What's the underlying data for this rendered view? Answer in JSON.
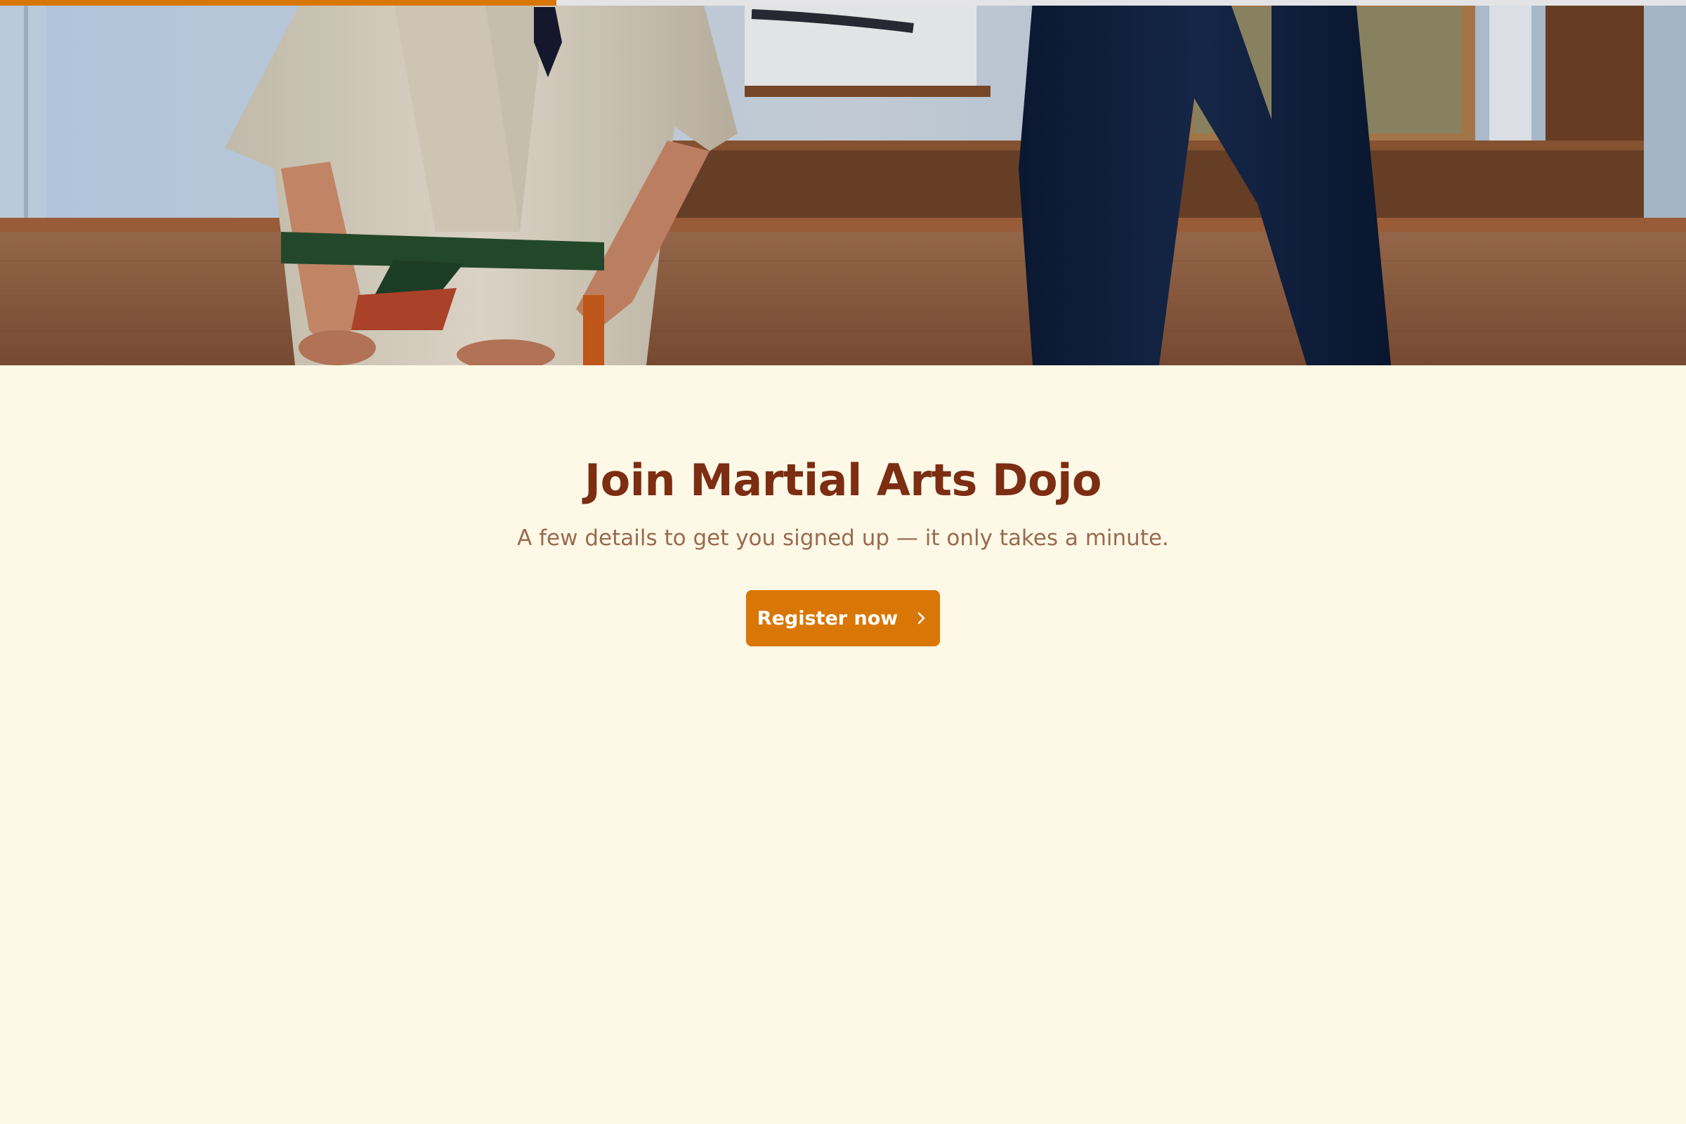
{
  "progress": {
    "percent": 33
  },
  "hero": {
    "alt_icon": "dojo-photo"
  },
  "signup": {
    "title": "Join Martial Arts Dojo",
    "subtitle": "A few details to get you signed up — it only takes a minute.",
    "register_label": "Register now",
    "register_icon": "chevron-right-icon"
  },
  "colors": {
    "background": "#fef9e7",
    "accent": "#d97706",
    "title": "#7c2d12",
    "subtitle": "#9a6a4f"
  }
}
